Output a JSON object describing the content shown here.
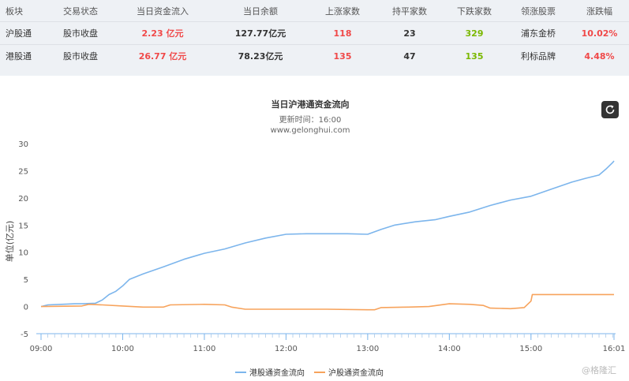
{
  "table": {
    "headers": [
      "板块",
      "交易状态",
      "当日资金流入",
      "当日余额",
      "上涨家数",
      "持平家数",
      "下跌家数",
      "领涨股票",
      "涨跌幅"
    ],
    "rows": [
      {
        "board": "沪股通",
        "status": "股市收盘",
        "inflow": "2.23 亿元",
        "balance": "127.77亿元",
        "up": "118",
        "flat": "23",
        "down": "329",
        "leader": "浦东金桥",
        "change": "10.02%"
      },
      {
        "board": "港股通",
        "status": "股市收盘",
        "inflow": "26.77 亿元",
        "balance": "78.23亿元",
        "up": "135",
        "flat": "47",
        "down": "135",
        "leader": "利标品牌",
        "change": "4.48%"
      }
    ]
  },
  "chart": {
    "title": "当日沪港通资金流向",
    "subtitle_time": "更新时间：16:00",
    "subtitle_site": "www.gelonghui.com",
    "ylabel": "单位(亿元)"
  },
  "watermark": "@格隆汇",
  "icons": {
    "refresh": "refresh-icon"
  },
  "colors": {
    "series_hk": "#7cb5ec",
    "series_sh": "#f7a35c",
    "red": "#f04848",
    "green": "#7ab800"
  },
  "chart_data": {
    "type": "line",
    "title": "当日沪港通资金流向",
    "ylabel": "单位(亿元)",
    "x_ticks": [
      "09:00",
      "10:00",
      "11:00",
      "12:00",
      "13:00",
      "14:00",
      "15:00",
      "16:01"
    ],
    "y_ticks": [
      -5,
      0,
      5,
      10,
      15,
      20,
      25,
      30
    ],
    "ylim": [
      -5,
      30
    ],
    "xlim": [
      "09:00",
      "16:01"
    ],
    "legend_position": "bottom-center",
    "grid": false,
    "series": [
      {
        "name": "港股通资金流向",
        "color": "#7cb5ec",
        "points": [
          [
            "09:00",
            0
          ],
          [
            "09:05",
            0.3
          ],
          [
            "09:15",
            0.4
          ],
          [
            "09:25",
            0.5
          ],
          [
            "09:30",
            0.5
          ],
          [
            "09:40",
            0.6
          ],
          [
            "09:45",
            1.2
          ],
          [
            "09:50",
            2.2
          ],
          [
            "09:55",
            2.8
          ],
          [
            "10:00",
            3.8
          ],
          [
            "10:05",
            5.0
          ],
          [
            "10:15",
            6.0
          ],
          [
            "10:30",
            7.3
          ],
          [
            "10:45",
            8.7
          ],
          [
            "11:00",
            9.8
          ],
          [
            "11:15",
            10.6
          ],
          [
            "11:30",
            11.7
          ],
          [
            "11:45",
            12.6
          ],
          [
            "12:00",
            13.3
          ],
          [
            "12:15",
            13.4
          ],
          [
            "12:45",
            13.4
          ],
          [
            "13:00",
            13.3
          ],
          [
            "13:10",
            14.2
          ],
          [
            "13:20",
            15.0
          ],
          [
            "13:35",
            15.6
          ],
          [
            "13:50",
            16.0
          ],
          [
            "14:00",
            16.6
          ],
          [
            "14:15",
            17.4
          ],
          [
            "14:30",
            18.6
          ],
          [
            "14:45",
            19.6
          ],
          [
            "15:00",
            20.3
          ],
          [
            "15:15",
            21.6
          ],
          [
            "15:30",
            22.9
          ],
          [
            "15:40",
            23.6
          ],
          [
            "15:50",
            24.2
          ],
          [
            "15:55",
            25.3
          ],
          [
            "16:00",
            26.5
          ],
          [
            "16:01",
            26.8
          ]
        ]
      },
      {
        "name": "沪股通资金流向",
        "color": "#f7a35c",
        "points": [
          [
            "09:00",
            0
          ],
          [
            "09:30",
            0.1
          ],
          [
            "09:35",
            0.4
          ],
          [
            "09:45",
            0.3
          ],
          [
            "10:00",
            0.1
          ],
          [
            "10:15",
            -0.1
          ],
          [
            "10:30",
            -0.1
          ],
          [
            "10:35",
            0.3
          ],
          [
            "11:00",
            0.4
          ],
          [
            "11:15",
            0.3
          ],
          [
            "11:20",
            -0.1
          ],
          [
            "11:30",
            -0.5
          ],
          [
            "12:00",
            -0.5
          ],
          [
            "12:30",
            -0.5
          ],
          [
            "13:00",
            -0.6
          ],
          [
            "13:05",
            -0.6
          ],
          [
            "13:10",
            -0.2
          ],
          [
            "13:30",
            -0.1
          ],
          [
            "13:45",
            0.0
          ],
          [
            "14:00",
            0.5
          ],
          [
            "14:15",
            0.4
          ],
          [
            "14:25",
            0.2
          ],
          [
            "14:30",
            -0.3
          ],
          [
            "14:45",
            -0.4
          ],
          [
            "14:55",
            -0.2
          ],
          [
            "15:00",
            1.0
          ],
          [
            "15:01",
            2.2
          ],
          [
            "15:30",
            2.2
          ],
          [
            "16:00",
            2.2
          ],
          [
            "16:01",
            2.2
          ]
        ]
      }
    ]
  }
}
